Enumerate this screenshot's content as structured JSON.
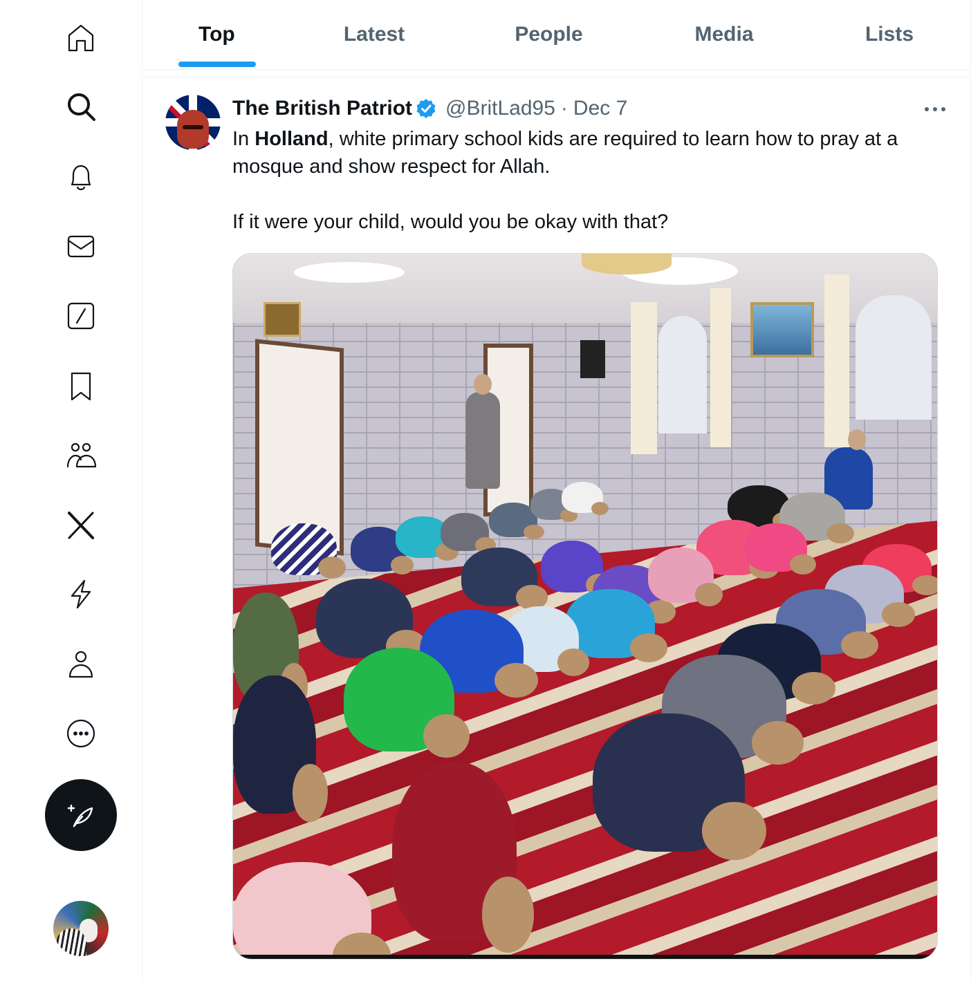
{
  "nav": {
    "items": [
      {
        "id": "home",
        "icon": "home-icon"
      },
      {
        "id": "explore",
        "icon": "search-icon"
      },
      {
        "id": "notifications",
        "icon": "bell-icon"
      },
      {
        "id": "messages",
        "icon": "mail-icon"
      },
      {
        "id": "grok",
        "icon": "grok-icon"
      },
      {
        "id": "bookmarks",
        "icon": "bookmark-icon"
      },
      {
        "id": "communities",
        "icon": "people-icon"
      },
      {
        "id": "premium",
        "icon": "x-logo-icon"
      },
      {
        "id": "verified-orgs",
        "icon": "lightning-icon"
      },
      {
        "id": "profile",
        "icon": "person-icon"
      },
      {
        "id": "more",
        "icon": "more-circle-icon"
      }
    ],
    "compose_icon": "feather-plus-icon"
  },
  "tabs": [
    {
      "label": "Top",
      "active": true
    },
    {
      "label": "Latest",
      "active": false
    },
    {
      "label": "People",
      "active": false
    },
    {
      "label": "Media",
      "active": false
    },
    {
      "label": "Lists",
      "active": false
    }
  ],
  "tweet": {
    "author_name": "The British Patriot",
    "verified": true,
    "handle": "@BritLad95",
    "separator": "·",
    "date": "Dec 7",
    "text": {
      "line1_prefix": "In ",
      "line1_bold": "Holland",
      "line1_rest": ", white primary school kids are required to learn how to pray at a mosque and show respect for Allah.",
      "line2": "If it were your child, would you be okay with that?"
    }
  },
  "colors": {
    "accent": "#1d9bf0",
    "text_primary": "#0f1419",
    "text_secondary": "#536471",
    "border": "#eff3f4"
  }
}
